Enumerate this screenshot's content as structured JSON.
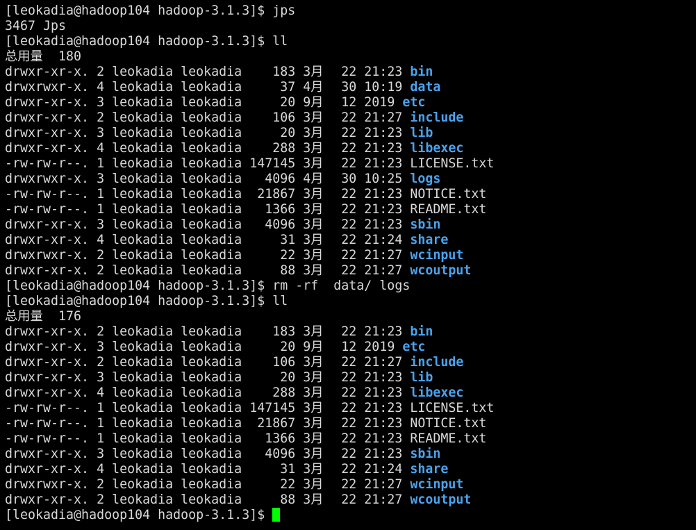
{
  "terminal": {
    "prompt": "[leokadia@hadoop104 hadoop-3.1.3]$ ",
    "colors": {
      "background": "#000000",
      "text": "#d9d9d9",
      "directory": "#4aa3ee",
      "cursor": "#00ff00"
    },
    "lines": [
      {
        "type": "cmd",
        "cmd": "jps"
      },
      {
        "type": "out",
        "text": "3467 Jps"
      },
      {
        "type": "cmd",
        "cmd": "ll"
      },
      {
        "type": "total",
        "label": "总用量",
        "value": " 180"
      },
      {
        "type": "ls",
        "pre": "drwxr-xr-x. 2 leokadia leokadia    183 ",
        "mon": "3月",
        "post": "  22 21:23 ",
        "name": "bin",
        "dir": true
      },
      {
        "type": "ls",
        "pre": "drwxrwxr-x. 4 leokadia leokadia     37 ",
        "mon": "4月",
        "post": "  30 10:19 ",
        "name": "data",
        "dir": true
      },
      {
        "type": "ls",
        "pre": "drwxr-xr-x. 3 leokadia leokadia     20 ",
        "mon": "9月",
        "post": "  12 2019 ",
        "name": "etc",
        "dir": true
      },
      {
        "type": "ls",
        "pre": "drwxr-xr-x. 2 leokadia leokadia    106 ",
        "mon": "3月",
        "post": "  22 21:27 ",
        "name": "include",
        "dir": true
      },
      {
        "type": "ls",
        "pre": "drwxr-xr-x. 3 leokadia leokadia     20 ",
        "mon": "3月",
        "post": "  22 21:23 ",
        "name": "lib",
        "dir": true
      },
      {
        "type": "ls",
        "pre": "drwxr-xr-x. 4 leokadia leokadia    288 ",
        "mon": "3月",
        "post": "  22 21:23 ",
        "name": "libexec",
        "dir": true
      },
      {
        "type": "ls",
        "pre": "-rw-rw-r--. 1 leokadia leokadia 147145 ",
        "mon": "3月",
        "post": "  22 21:23 ",
        "name": "LICENSE.txt",
        "dir": false
      },
      {
        "type": "ls",
        "pre": "drwxrwxr-x. 3 leokadia leokadia   4096 ",
        "mon": "4月",
        "post": "  30 10:25 ",
        "name": "logs",
        "dir": true
      },
      {
        "type": "ls",
        "pre": "-rw-rw-r--. 1 leokadia leokadia  21867 ",
        "mon": "3月",
        "post": "  22 21:23 ",
        "name": "NOTICE.txt",
        "dir": false
      },
      {
        "type": "ls",
        "pre": "-rw-rw-r--. 1 leokadia leokadia   1366 ",
        "mon": "3月",
        "post": "  22 21:23 ",
        "name": "README.txt",
        "dir": false
      },
      {
        "type": "ls",
        "pre": "drwxr-xr-x. 3 leokadia leokadia   4096 ",
        "mon": "3月",
        "post": "  22 21:23 ",
        "name": "sbin",
        "dir": true
      },
      {
        "type": "ls",
        "pre": "drwxr-xr-x. 4 leokadia leokadia     31 ",
        "mon": "3月",
        "post": "  22 21:24 ",
        "name": "share",
        "dir": true
      },
      {
        "type": "ls",
        "pre": "drwxrwxr-x. 2 leokadia leokadia     22 ",
        "mon": "3月",
        "post": "  22 21:27 ",
        "name": "wcinput",
        "dir": true
      },
      {
        "type": "ls",
        "pre": "drwxr-xr-x. 2 leokadia leokadia     88 ",
        "mon": "3月",
        "post": "  22 21:27 ",
        "name": "wcoutput",
        "dir": true
      },
      {
        "type": "cmd",
        "cmd": "rm -rf  data/ logs"
      },
      {
        "type": "cmd",
        "cmd": "ll"
      },
      {
        "type": "total",
        "label": "总用量",
        "value": " 176"
      },
      {
        "type": "ls",
        "pre": "drwxr-xr-x. 2 leokadia leokadia    183 ",
        "mon": "3月",
        "post": "  22 21:23 ",
        "name": "bin",
        "dir": true
      },
      {
        "type": "ls",
        "pre": "drwxr-xr-x. 3 leokadia leokadia     20 ",
        "mon": "9月",
        "post": "  12 2019 ",
        "name": "etc",
        "dir": true
      },
      {
        "type": "ls",
        "pre": "drwxr-xr-x. 2 leokadia leokadia    106 ",
        "mon": "3月",
        "post": "  22 21:27 ",
        "name": "include",
        "dir": true
      },
      {
        "type": "ls",
        "pre": "drwxr-xr-x. 3 leokadia leokadia     20 ",
        "mon": "3月",
        "post": "  22 21:23 ",
        "name": "lib",
        "dir": true
      },
      {
        "type": "ls",
        "pre": "drwxr-xr-x. 4 leokadia leokadia    288 ",
        "mon": "3月",
        "post": "  22 21:23 ",
        "name": "libexec",
        "dir": true
      },
      {
        "type": "ls",
        "pre": "-rw-rw-r--. 1 leokadia leokadia 147145 ",
        "mon": "3月",
        "post": "  22 21:23 ",
        "name": "LICENSE.txt",
        "dir": false
      },
      {
        "type": "ls",
        "pre": "-rw-rw-r--. 1 leokadia leokadia  21867 ",
        "mon": "3月",
        "post": "  22 21:23 ",
        "name": "NOTICE.txt",
        "dir": false
      },
      {
        "type": "ls",
        "pre": "-rw-rw-r--. 1 leokadia leokadia   1366 ",
        "mon": "3月",
        "post": "  22 21:23 ",
        "name": "README.txt",
        "dir": false
      },
      {
        "type": "ls",
        "pre": "drwxr-xr-x. 3 leokadia leokadia   4096 ",
        "mon": "3月",
        "post": "  22 21:23 ",
        "name": "sbin",
        "dir": true
      },
      {
        "type": "ls",
        "pre": "drwxr-xr-x. 4 leokadia leokadia     31 ",
        "mon": "3月",
        "post": "  22 21:24 ",
        "name": "share",
        "dir": true
      },
      {
        "type": "ls",
        "pre": "drwxrwxr-x. 2 leokadia leokadia     22 ",
        "mon": "3月",
        "post": "  22 21:27 ",
        "name": "wcinput",
        "dir": true
      },
      {
        "type": "ls",
        "pre": "drwxr-xr-x. 2 leokadia leokadia     88 ",
        "mon": "3月",
        "post": "  22 21:27 ",
        "name": "wcoutput",
        "dir": true
      },
      {
        "type": "input",
        "cmd": ""
      }
    ]
  }
}
